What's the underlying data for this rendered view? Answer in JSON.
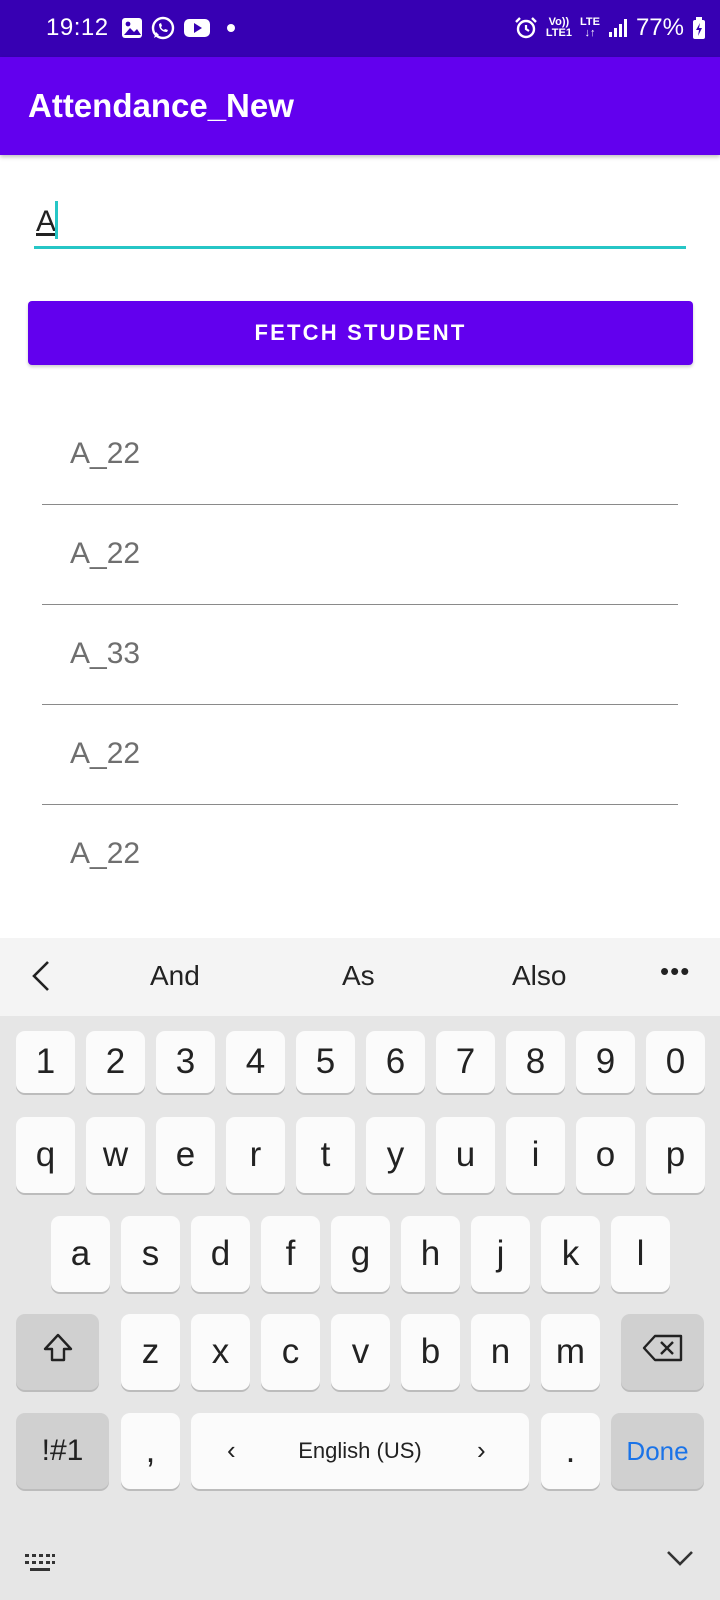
{
  "status_bar": {
    "time": "19:12",
    "left_icons": [
      "gallery-icon",
      "whatsapp-icon",
      "youtube-icon",
      "dot-icon"
    ],
    "net_vol": "Vo))",
    "net_lte1": "LTE1",
    "net_lte": "LTE",
    "net_arrows": "↓↑",
    "battery": "77%"
  },
  "app_bar": {
    "title": "Attendance_New"
  },
  "input": {
    "value": "A",
    "accent_color": "#26c6c6"
  },
  "fetch_button": {
    "label": "FETCH STUDENT"
  },
  "students": [
    {
      "label": "A_22"
    },
    {
      "label": "A_22"
    },
    {
      "label": "A_33"
    },
    {
      "label": "A_22"
    },
    {
      "label": "A_22"
    }
  ],
  "suggestions": [
    "And",
    "As",
    "Also"
  ],
  "keyboard": {
    "number_row": [
      "1",
      "2",
      "3",
      "4",
      "5",
      "6",
      "7",
      "8",
      "9",
      "0"
    ],
    "row1": [
      "q",
      "w",
      "e",
      "r",
      "t",
      "y",
      "u",
      "i",
      "o",
      "p"
    ],
    "row2": [
      "a",
      "s",
      "d",
      "f",
      "g",
      "h",
      "j",
      "k",
      "l"
    ],
    "row3": [
      "z",
      "x",
      "c",
      "v",
      "b",
      "n",
      "m"
    ],
    "symbols_label": "!#1",
    "comma": ",",
    "language": "English (US)",
    "period": ".",
    "done_label": "Done"
  },
  "colors": {
    "status_bar": "#3700b3",
    "primary": "#6200ee",
    "done": "#1a73e8"
  }
}
